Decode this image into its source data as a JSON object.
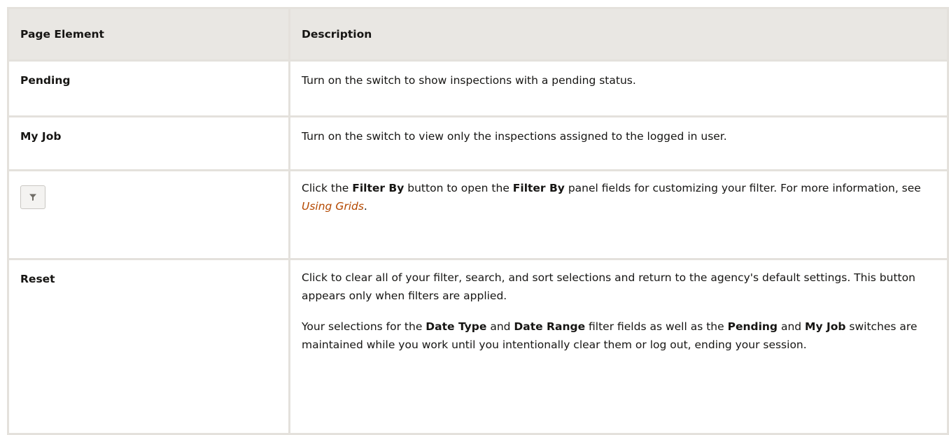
{
  "table": {
    "headers": [
      "Page Element",
      "Description"
    ],
    "rows": [
      {
        "element": "Pending",
        "description": "Turn on the switch to show inspections with a pending status."
      },
      {
        "element": "My Job",
        "description": "Turn on the switch to view only the inspections assigned to the logged in user."
      },
      {
        "element_icon": "filter-funnel-icon",
        "description_parts": [
          "Click the ",
          "Filter By",
          " button to open the ",
          "Filter By",
          " panel fields for customizing your filter. For more information, see ",
          "Using Grids",
          "."
        ]
      },
      {
        "element": "Reset",
        "description_p1": "Click to clear all of your filter, search, and sort selections and return to the agency's default settings. This button appears only when filters are applied.",
        "description_p2_parts": [
          "Your selections for the ",
          "Date Type",
          " and ",
          "Date Range",
          " filter fields as well as the ",
          "Pending",
          " and ",
          "My Job",
          " switches are maintained while you work until you intentionally clear them or log out, ending your session."
        ]
      }
    ]
  },
  "colors": {
    "border": "#e4e1dc",
    "header_bg": "#e9e7e3",
    "link": "#b44800"
  }
}
